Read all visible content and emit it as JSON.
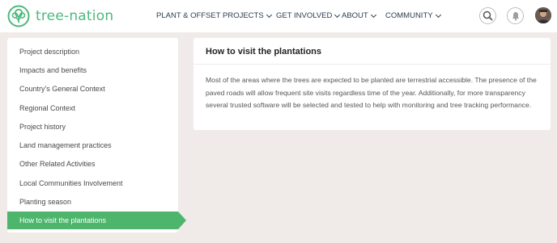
{
  "brand": {
    "name": "tree-nation",
    "color": "#4db87d"
  },
  "nav": {
    "items": [
      {
        "label": "PLANT & OFFSET",
        "dropdown": false
      },
      {
        "label": "PROJECTS",
        "dropdown": true
      },
      {
        "label": "GET INVOLVED",
        "dropdown": true
      },
      {
        "label": "ABOUT",
        "dropdown": true
      },
      {
        "label": "COMMUNITY",
        "dropdown": true
      }
    ],
    "icons": [
      "search-icon",
      "bell-icon",
      "avatar"
    ]
  },
  "sidebar": {
    "items": [
      {
        "label": "Project description"
      },
      {
        "label": "Impacts and benefits"
      },
      {
        "label": "Country's General Context"
      },
      {
        "label": "Regional Context"
      },
      {
        "label": "Project history"
      },
      {
        "label": "Land management practices"
      },
      {
        "label": "Other Related Activities"
      },
      {
        "label": "Local Communities Involvement"
      },
      {
        "label": "Planting season"
      },
      {
        "label": "How to visit the plantations"
      }
    ],
    "active_index": 9,
    "active_color": "#4db66c"
  },
  "content": {
    "title": "How to visit the plantations",
    "body": "Most of the areas where the trees are expected to be planted are terrestrial accessible. The presence of the paved roads will allow frequent site visits regardless time of the year. Additionally, for more transparency several trusted software will be selected and tested to help with monitoring and tree tracking performance."
  }
}
